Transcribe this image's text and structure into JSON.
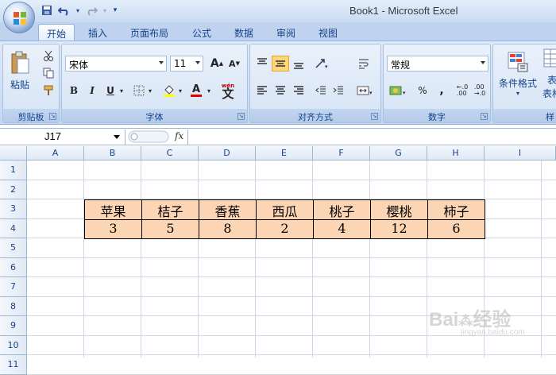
{
  "window": {
    "title": "Book1 - Microsoft Excel"
  },
  "tabs": [
    {
      "label": "开始",
      "active": true
    },
    {
      "label": "插入"
    },
    {
      "label": "页面布局"
    },
    {
      "label": "公式"
    },
    {
      "label": "数据"
    },
    {
      "label": "审阅"
    },
    {
      "label": "视图"
    }
  ],
  "ribbon": {
    "clipboard": {
      "label": "剪贴板",
      "paste": "粘贴"
    },
    "font": {
      "label": "字体",
      "name": "宋体",
      "size": "11",
      "bold": "B",
      "italic": "I",
      "underline": "U",
      "grow": "A",
      "shrink": "A",
      "color_letter": "A",
      "phonetic": "文"
    },
    "alignment": {
      "label": "对齐方式"
    },
    "number": {
      "label": "数字",
      "format": "常规",
      "percent": "%",
      "comma": ","
    },
    "styles": {
      "conditional_format": "条件格式",
      "table_partial": "表",
      "table_partial2": "表格"
    }
  },
  "formula_bar": {
    "name_box": "J17",
    "fx": "fx",
    "content": ""
  },
  "columns": [
    "A",
    "B",
    "C",
    "D",
    "E",
    "F",
    "G",
    "H",
    "I"
  ],
  "rows": [
    "1",
    "2",
    "3",
    "4",
    "5",
    "6",
    "7",
    "8",
    "9",
    "10",
    "11"
  ],
  "table": {
    "headers": [
      "苹果",
      "桔子",
      "香蕉",
      "西瓜",
      "桃子",
      "樱桃",
      "柿子"
    ],
    "values": [
      "3",
      "5",
      "8",
      "2",
      "4",
      "12",
      "6"
    ]
  },
  "colors": {
    "cell_fill": "#fcd5b4",
    "ribbon": "#d1e0f4"
  },
  "watermark": {
    "text": "Bai经验",
    "sub": "jingyan.baidu.com"
  }
}
